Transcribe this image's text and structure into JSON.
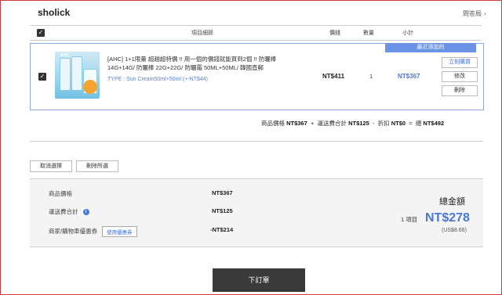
{
  "store": {
    "name": "sholick",
    "qa_label": "問答局"
  },
  "cart_header": {
    "col_item": "項目細節",
    "col_price": "價錢",
    "col_qty": "數量",
    "col_subtotal": "小計"
  },
  "product": {
    "recent_badge": "最近添加的",
    "name": "[AHC] 1+1限量 超越超特價 !! 用一個的價錢就能買到2個 !! 防曬棒14G+14G/ 防曬棒 22G+22G/ 防曬霜 50ML+50ML/ 韓國直郵",
    "type": "TYPE : Sun Cream50ml+50ml (+-NT$44)",
    "price": "NT$411",
    "qty": "1",
    "subtotal": "NT$367",
    "actions": {
      "buy_now": "立刻購買",
      "edit": "修改",
      "delete": "刪除"
    }
  },
  "totals_line": {
    "goods_label": "商品價格",
    "goods_value": "NT$367",
    "plus": "+",
    "shipping_label": "運送費合計",
    "shipping_value": "NT$125",
    "minus": "-",
    "discount_label": "折扣",
    "discount_value": "NT$0",
    "equals": "=",
    "total_label": "總",
    "total_value": "NT$492"
  },
  "bulk": {
    "cancel_select": "取消選擇",
    "delete_selected": "刪除所選"
  },
  "summary": {
    "goods_label": "商品價格",
    "goods_value": "NT$367",
    "shipping_label": "運送費合計",
    "shipping_value": "NT$125",
    "coupon_label": "商家/購物車優惠券",
    "coupon_button": "使用優惠券",
    "coupon_value": "-NT$214",
    "grand_label": "總金額",
    "items_count": "1 項目",
    "grand_value": "NT$278",
    "usd_value": "(US$8.66)"
  },
  "order_button": "下訂單",
  "colors": {
    "accent": "#4a78d8",
    "badge": "#6c93e8",
    "order_button": "#3a3a3a",
    "frame": "#d23b3b"
  }
}
